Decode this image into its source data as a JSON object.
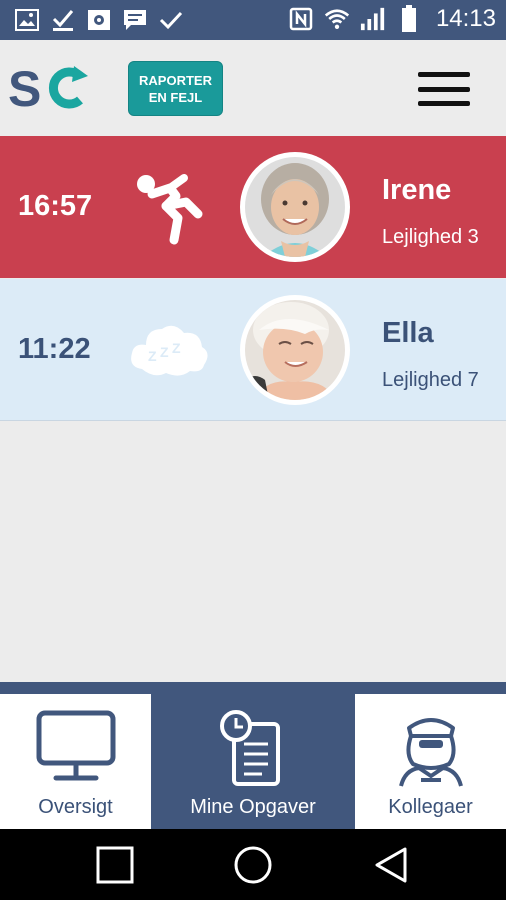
{
  "status_bar": {
    "time": "14:13",
    "left_icons": [
      "image-icon",
      "download-done-icon",
      "settings-notification-icon",
      "message-icon",
      "check-icon"
    ],
    "right_icons": [
      "nfc-icon",
      "wifi-icon",
      "signal-icon",
      "battery-icon"
    ]
  },
  "header": {
    "logo_text": "SC",
    "report_button_line1": "RAPORTER",
    "report_button_line2": "EN FEJL",
    "menu_icon": "hamburger-menu-icon"
  },
  "colors": {
    "primary": "#41577d",
    "alert": "#c9404f",
    "calm": "#dcebf7",
    "accent": "#1a9a9a"
  },
  "residents": [
    {
      "time": "16:57",
      "status": "fall",
      "status_icon": "falling-person-icon",
      "name": "Irene",
      "apartment": "Lejlighed 3"
    },
    {
      "time": "11:22",
      "status": "sleeping",
      "status_icon": "sleep-cloud-icon",
      "name": "Ella",
      "apartment": "Lejlighed 7"
    }
  ],
  "bottom_nav": {
    "tabs": [
      {
        "label": "Oversigt",
        "icon": "monitor-icon",
        "active": false
      },
      {
        "label": "Mine Opgaver",
        "icon": "clipboard-clock-icon",
        "active": true
      },
      {
        "label": "Kollegaer",
        "icon": "nurse-icon",
        "active": false
      }
    ]
  },
  "system_nav": [
    "recent-apps-icon",
    "home-icon",
    "back-icon"
  ]
}
